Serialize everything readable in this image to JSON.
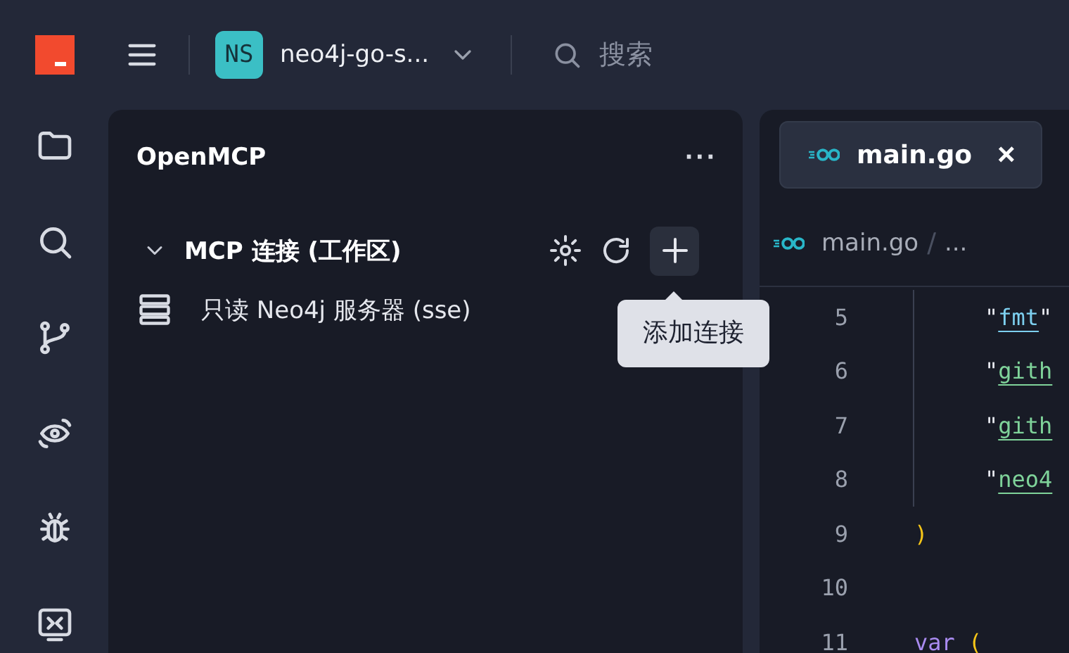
{
  "topbar": {
    "project_badge": "NS",
    "project_name": "neo4j-go-s...",
    "search": {
      "placeholder": "搜索"
    }
  },
  "activity_bar": [
    {
      "kind": "folder",
      "selected": false
    },
    {
      "kind": "search",
      "selected": false
    },
    {
      "kind": "branch",
      "selected": false
    },
    {
      "kind": "eye",
      "selected": false
    },
    {
      "kind": "bug",
      "selected": false
    },
    {
      "kind": "remote",
      "selected": false
    }
  ],
  "sidebar": {
    "title": "OpenMCP",
    "more": "···",
    "section": {
      "title": "MCP 连接 (工作区)",
      "expanded": true,
      "items": [
        {
          "label": "只读 Neo4j 服务器 (sse)"
        }
      ]
    },
    "tooltip": "添加连接"
  },
  "editor": {
    "tabs": [
      {
        "label": "main.go",
        "selected": true,
        "close": "×"
      }
    ],
    "breadcrumb": {
      "items": [
        "main.go",
        "..."
      ],
      "separator": "/"
    },
    "lines": [
      {
        "number": "5",
        "indent": true,
        "tokens": [
          {
            "text": "\"",
            "kind": "punct"
          },
          {
            "text": "fmt",
            "kind": "module"
          },
          {
            "text": "\"",
            "kind": "punct"
          }
        ]
      },
      {
        "number": "6",
        "indent": true,
        "tokens": [
          {
            "text": "\"",
            "kind": "punct"
          },
          {
            "text": "gith",
            "kind": "string"
          }
        ]
      },
      {
        "number": "7",
        "indent": true,
        "tokens": [
          {
            "text": "\"",
            "kind": "punct"
          },
          {
            "text": "gith",
            "kind": "string"
          }
        ]
      },
      {
        "number": "8",
        "indent": true,
        "tokens": [
          {
            "text": "\"",
            "kind": "punct"
          },
          {
            "text": "neo4",
            "kind": "string"
          }
        ]
      },
      {
        "number": "9",
        "indent": false,
        "tokens": [
          {
            "text": ")",
            "kind": "bracket"
          }
        ]
      },
      {
        "number": "10",
        "indent": false
      },
      {
        "number": "11",
        "indent": false,
        "tokens": [
          {
            "text": "var",
            "kind": "keyword"
          },
          {
            "text": "(",
            "kind": "bracket"
          }
        ]
      }
    ]
  }
}
